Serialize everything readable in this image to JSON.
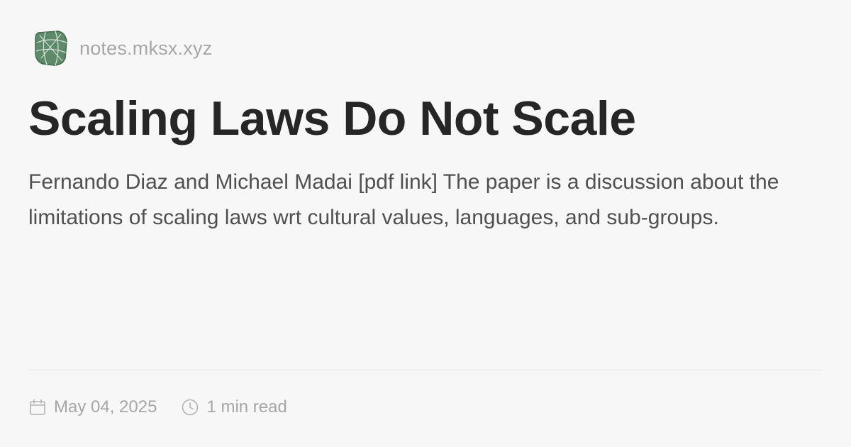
{
  "site": {
    "name": "notes.mksx.xyz",
    "logo_icon": "site-logo-icon",
    "logo_color": "#5e8a6b"
  },
  "post": {
    "title": "Scaling Laws Do Not Scale",
    "description": "Fernando Diaz and Michael Madai [pdf link] The paper is a discussion about the limitations of scaling laws wrt cultural values, languages, and sub-groups."
  },
  "meta": {
    "date": "May 04, 2025",
    "date_icon": "calendar-icon",
    "read_time": "1 min read",
    "read_time_icon": "clock-icon"
  },
  "colors": {
    "background": "#f8f7f8",
    "title": "#262626",
    "body_text": "#505050",
    "muted": "#a6a6a6",
    "divider": "#e6e5e6"
  }
}
